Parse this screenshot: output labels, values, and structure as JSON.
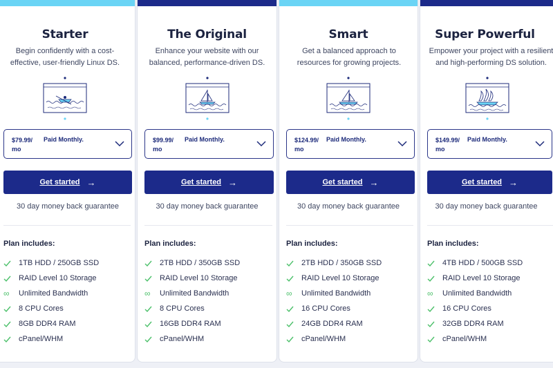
{
  "colors": {
    "accent_light": "#6ad4f5",
    "accent_dark": "#1c2a8a",
    "check_green": "#4cc06a"
  },
  "plans": [
    {
      "title": "Starter",
      "description": "Begin confidently with a cost-effective, user-friendly Linux DS.",
      "illustration": "rowboat-icon",
      "price": "$79.99/ mo",
      "billing": "Paid Monthly.",
      "cta": "Get started",
      "guarantee": "30 day money back guarantee",
      "includes_label": "Plan includes:",
      "features": [
        "1TB HDD / 250GB SSD",
        "RAID Level 10 Storage",
        "Unlimited Bandwidth",
        "8 CPU Cores",
        "8GB DDR4 RAM",
        "cPanel/WHM"
      ]
    },
    {
      "title": "The Original",
      "description": "Enhance your website with our balanced, performance-driven DS.",
      "illustration": "sailboat-icon",
      "price": "$99.99/ mo",
      "billing": "Paid Monthly.",
      "cta": "Get started",
      "guarantee": "30 day money back guarantee",
      "includes_label": "Plan includes:",
      "features": [
        "2TB HDD / 350GB SSD",
        "RAID Level 10 Storage",
        "Unlimited Bandwidth",
        "8 CPU Cores",
        "16GB DDR4 RAM",
        "cPanel/WHM"
      ]
    },
    {
      "title": "Smart",
      "description": "Get a balanced approach to resources for growing projects.",
      "illustration": "sailboat-icon",
      "price": "$124.99/ mo",
      "billing": "Paid Monthly.",
      "cta": "Get started",
      "guarantee": "30 day money back guarantee",
      "includes_label": "Plan includes:",
      "features": [
        "2TB HDD / 350GB SSD",
        "RAID Level 10 Storage",
        "Unlimited Bandwidth",
        "16 CPU Cores",
        "24GB DDR4 RAM",
        "cPanel/WHM"
      ]
    },
    {
      "title": "Super Powerful",
      "description": "Empower your project with a resilient and high-performing DS solution.",
      "illustration": "ship-icon",
      "price": "$149.99/ mo",
      "billing": "Paid Monthly.",
      "cta": "Get started",
      "guarantee": "30 day money back guarantee",
      "includes_label": "Plan includes:",
      "features": [
        "4TB HDD / 500GB SSD",
        "RAID Level 10 Storage",
        "Unlimited Bandwidth",
        "16 CPU Cores",
        "32GB DDR4 RAM",
        "cPanel/WHM"
      ]
    }
  ]
}
